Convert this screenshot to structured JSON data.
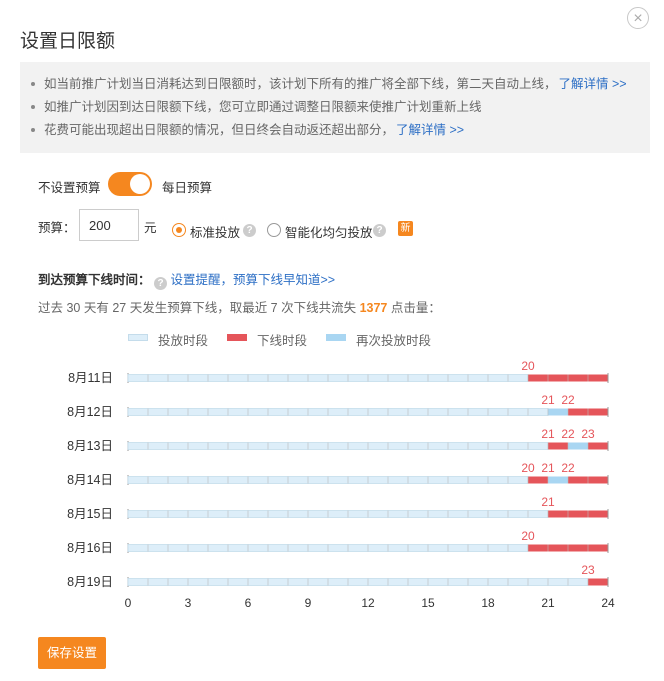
{
  "dialog": {
    "title": "设置日限额",
    "close_icon": "close-icon"
  },
  "notice": {
    "items": [
      {
        "text": "如当前推广计划当日消耗达到日限额时，该计划下所有的推广将全部下线，第二天自动上线，",
        "link": "了解详情 >>"
      },
      {
        "text": "如推广计划因到达日限额下线，您可立即通过调整日限额来使推广计划重新上线",
        "link": ""
      },
      {
        "text": "花费可能出现超出日限额的情况，但日终会自动返还超出部分，",
        "link": "了解详情 >>"
      }
    ]
  },
  "budget_type": {
    "off_label": "不设置预算",
    "on_label": "每日预算",
    "enabled": true
  },
  "budget": {
    "label": "预算：",
    "value": "200",
    "unit": "元",
    "option_standard": "标准投放",
    "option_smart": "智能化均匀投放",
    "selected": "standard",
    "new_badge": "新"
  },
  "offline": {
    "heading": "到达预算下线时间：",
    "remind_link": "设置提醒，预算下线早知道>>",
    "summary_prefix": "过去 30 天有 27 天发生预算下线，取最近 7 次下线共流失 ",
    "lost_clicks": "1377",
    "summary_suffix": " 点击量："
  },
  "colors": {
    "accent": "#f5871f",
    "serving": "#ddeef9",
    "offline": "#e5555a",
    "reserve": "#a9d6f2",
    "link": "#2d6fc5"
  },
  "chart_data": {
    "type": "bar",
    "legend": [
      "投放时段",
      "下线时段",
      "再次投放时段"
    ],
    "legend_position": "top-left",
    "xlim": [
      0,
      24
    ],
    "x_ticks": [
      0,
      3,
      6,
      9,
      12,
      15,
      18,
      21,
      24
    ],
    "rows": [
      {
        "date": "8月11日",
        "segments": [
          {
            "from": 0,
            "to": 20,
            "state": "serving"
          },
          {
            "from": 20,
            "to": 24,
            "state": "offline"
          }
        ],
        "labels": [
          20
        ]
      },
      {
        "date": "8月12日",
        "segments": [
          {
            "from": 0,
            "to": 21,
            "state": "serving"
          },
          {
            "from": 21,
            "to": 22,
            "state": "reserve"
          },
          {
            "from": 22,
            "to": 24,
            "state": "offline"
          }
        ],
        "labels": [
          21,
          22
        ]
      },
      {
        "date": "8月13日",
        "segments": [
          {
            "from": 0,
            "to": 21,
            "state": "serving"
          },
          {
            "from": 21,
            "to": 22,
            "state": "offline"
          },
          {
            "from": 22,
            "to": 23,
            "state": "reserve"
          },
          {
            "from": 23,
            "to": 24,
            "state": "offline"
          }
        ],
        "labels": [
          21,
          22,
          23
        ]
      },
      {
        "date": "8月14日",
        "segments": [
          {
            "from": 0,
            "to": 20,
            "state": "serving"
          },
          {
            "from": 20,
            "to": 21,
            "state": "offline"
          },
          {
            "from": 21,
            "to": 22,
            "state": "reserve"
          },
          {
            "from": 22,
            "to": 24,
            "state": "offline"
          }
        ],
        "labels": [
          20,
          21,
          22
        ]
      },
      {
        "date": "8月15日",
        "segments": [
          {
            "from": 0,
            "to": 21,
            "state": "serving"
          },
          {
            "from": 21,
            "to": 24,
            "state": "offline"
          }
        ],
        "labels": [
          21
        ]
      },
      {
        "date": "8月16日",
        "segments": [
          {
            "from": 0,
            "to": 20,
            "state": "serving"
          },
          {
            "from": 20,
            "to": 24,
            "state": "offline"
          }
        ],
        "labels": [
          20
        ]
      },
      {
        "date": "8月19日",
        "segments": [
          {
            "from": 0,
            "to": 23,
            "state": "serving"
          },
          {
            "from": 23,
            "to": 24,
            "state": "offline"
          }
        ],
        "labels": [
          23
        ]
      }
    ]
  },
  "footer": {
    "save_label": "保存设置"
  }
}
